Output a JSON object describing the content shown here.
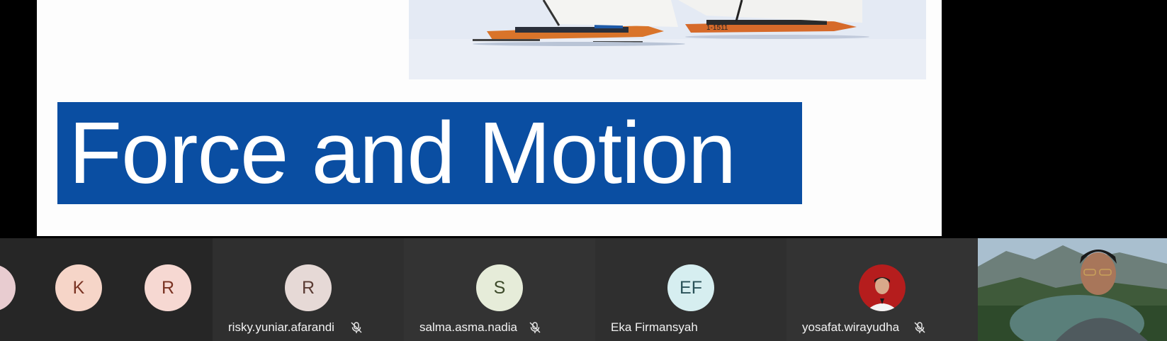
{
  "slide": {
    "title": "Force and Motion",
    "title_bg": "#0a4ea2",
    "photo_label": "ice-sailing-photo",
    "sail_number": "1-1511"
  },
  "participants": [
    {
      "initials": "",
      "name": "",
      "avatar_color": "#e8ccd0"
    },
    {
      "initials": "K",
      "name": "",
      "avatar_color": "#f6d5c8"
    },
    {
      "initials": "R",
      "name": "",
      "avatar_color": "#f6d8d2"
    },
    {
      "initials": "R",
      "name": "risky.yuniar.afarandi",
      "avatar_color": "#e6d9d6",
      "muted": true
    },
    {
      "initials": "S",
      "name": "salma.asma.nadia",
      "avatar_color": "#e6ecd9",
      "muted": true
    },
    {
      "initials": "EF",
      "name": "Eka Firmansyah",
      "avatar_color": "#d6eef0",
      "muted": false
    },
    {
      "initials": "",
      "name": "yosafat.wirayudha",
      "avatar_color": "#b51d1d",
      "muted": true,
      "photo": true
    }
  ],
  "icons": {
    "mute": "mic-off-icon"
  }
}
